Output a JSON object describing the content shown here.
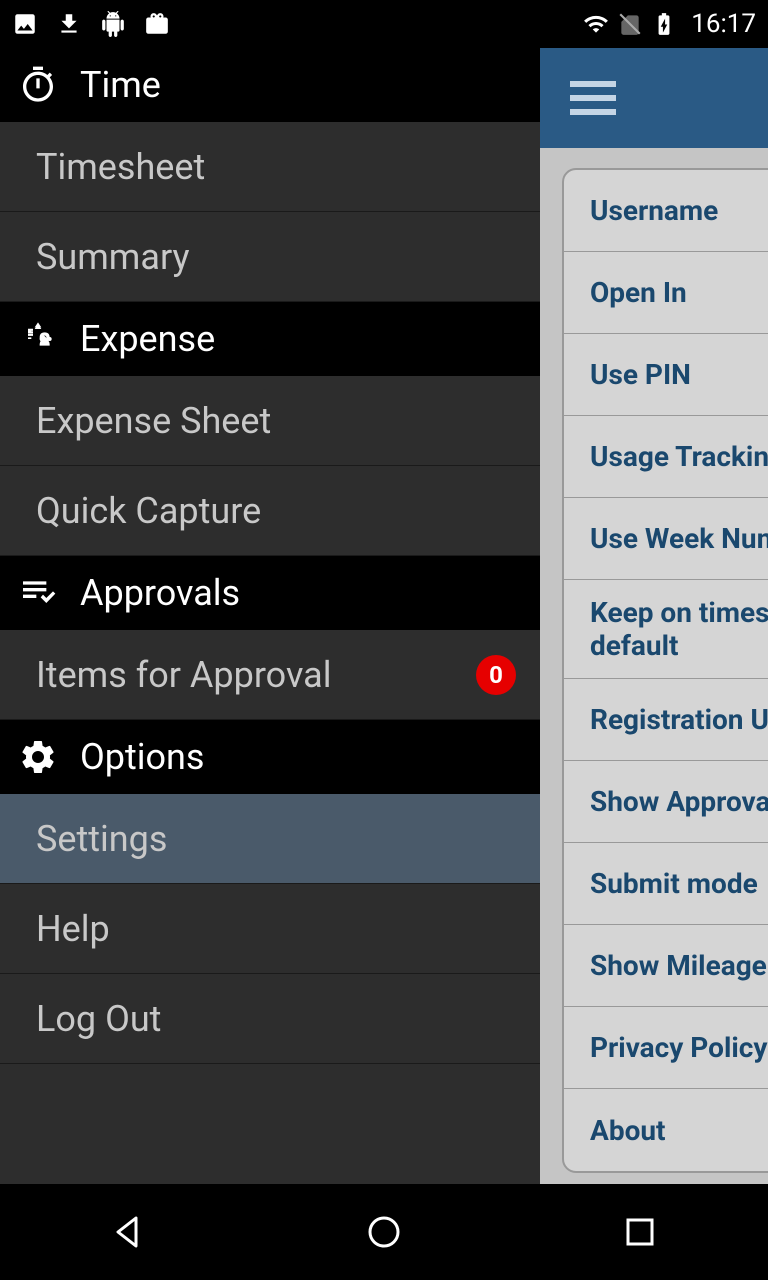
{
  "status": {
    "time": "16:17"
  },
  "drawer": {
    "sections": [
      {
        "title": "Time",
        "items": [
          {
            "label": "Timesheet"
          },
          {
            "label": "Summary"
          }
        ]
      },
      {
        "title": "Expense",
        "items": [
          {
            "label": "Expense Sheet"
          },
          {
            "label": "Quick Capture"
          }
        ]
      },
      {
        "title": "Approvals",
        "items": [
          {
            "label": "Items for Approval",
            "badge": "0"
          }
        ]
      },
      {
        "title": "Options",
        "items": [
          {
            "label": "Settings",
            "selected": true
          },
          {
            "label": "Help"
          },
          {
            "label": "Log Out"
          }
        ]
      }
    ]
  },
  "settings": {
    "rows": [
      {
        "label": "Username"
      },
      {
        "label": "Open In"
      },
      {
        "label": "Use PIN"
      },
      {
        "label": "Usage Tracking"
      },
      {
        "label": "Use Week Numb"
      },
      {
        "label": "Keep on timesheet by default"
      },
      {
        "label": "Registration Unit"
      },
      {
        "label": "Show Approvals"
      },
      {
        "label": "Submit mode"
      },
      {
        "label": "Show Mileage"
      },
      {
        "label": "Privacy Policy"
      },
      {
        "label": "About"
      }
    ]
  }
}
